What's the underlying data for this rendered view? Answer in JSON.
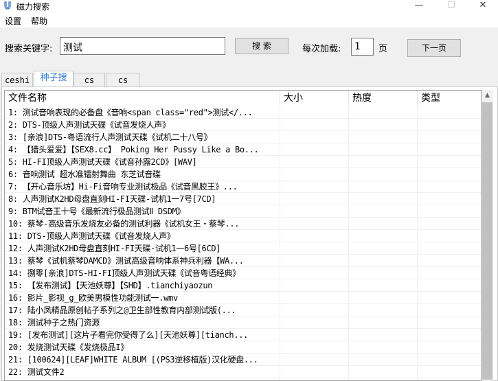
{
  "window": {
    "title": "磁力搜索",
    "minimize": "—",
    "maximize": "☐",
    "close": "✕"
  },
  "menu": [
    "设置",
    "帮助"
  ],
  "search": {
    "keyword_label": "搜索关键字:",
    "keyword_value": "测试",
    "search_button": "搜 索",
    "per_load_label": "每次加载:",
    "per_load_value": "1",
    "page_unit": "页",
    "next_button": "下一页"
  },
  "tabs": [
    {
      "label": "ceshi",
      "active": false
    },
    {
      "label": "种子搜",
      "active": true
    },
    {
      "label": "cs",
      "active": false
    },
    {
      "label": "cs",
      "active": false
    }
  ],
  "table": {
    "columns": [
      "文件名称",
      "大小",
      "热度",
      "类型"
    ],
    "rows": [
      [
        "1: 测试音响表现的必备盘《音响<span class=\"red\">测试</...",
        "",
        "",
        ""
      ],
      [
        "2: DTS-顶级人声测试天碟《试音发烧人声》",
        "",
        "",
        ""
      ],
      [
        "3: [亲浪]DTS-粤语流行人声测试天碟《试机二十八号》",
        "",
        "",
        ""
      ],
      [
        "4: 【猎头爱爱】【SEX8.cc】 Poking Her Pussy Like a Bo...",
        "",
        "",
        ""
      ],
      [
        "5: HI-FI顶级人声测试天碟《试音孙露2CD》[WAV]",
        "",
        "",
        ""
      ],
      [
        "6: 音响测试 超水准镭射舞曲 东芝试音碟",
        "",
        "",
        ""
      ],
      [
        "7: 【开心音乐坊】Hi-Fi音响专业测试极品《试音黑胶王》...",
        "",
        "",
        ""
      ],
      [
        "8: 人声测试K2HD母盘直刻HI-FI天碟-试机1一7号[7CD]",
        "",
        "",
        ""
      ],
      [
        "9: BTM试音王十号《最新流行极品测试Ⅱ DSDM》",
        "",
        "",
        ""
      ],
      [
        "10: 蔡琴-高级音乐发烧友必备的测试利器《试机女王・蔡琴...",
        "",
        "",
        ""
      ],
      [
        "11: DTS-顶级人声测试天碟《试音发烧人声》",
        "",
        "",
        ""
      ],
      [
        "12: 人声测试K2HD母盘直刻HI-FI天碟-试机1一6号[6CD]",
        "",
        "",
        ""
      ],
      [
        "13: 蔡琴《试机蔡琴DAMCD》测试高级音响体系神兵利器【WA...",
        "",
        "",
        ""
      ],
      [
        "14: 捌零[亲浪]DTS-HI-FI顶级人声测试天碟《试音粤语经典》",
        "",
        "",
        ""
      ],
      [
        "15: 【发布测试】【天池妖尊】【SHD】.tianchiyaozun",
        "",
        "",
        ""
      ],
      [
        "16: 影片_影视_g_欧美男模性功能测试一.wmv",
        "",
        "",
        ""
      ],
      [
        "17: 陆小凤精品原创帖子系列之@卫生部性教育内部测试版(...",
        "",
        "",
        ""
      ],
      [
        "18: 测试种子之热门资源",
        "",
        "",
        ""
      ],
      [
        "19: [发布测试][这片子看完你受得了么][天池妖尊][tianch...",
        "",
        "",
        ""
      ],
      [
        "20: 发烧测试天碟《发烧极品I》",
        "",
        "",
        ""
      ],
      [
        "21: [100624][LEAF]WHITE ALBUM [(PS3逆移植版)汉化硬盘...",
        "",
        "",
        ""
      ],
      [
        "22: 测试文件2",
        "",
        "",
        ""
      ],
      [
        "23: 测试测试",
        "",
        "",
        ""
      ]
    ]
  }
}
